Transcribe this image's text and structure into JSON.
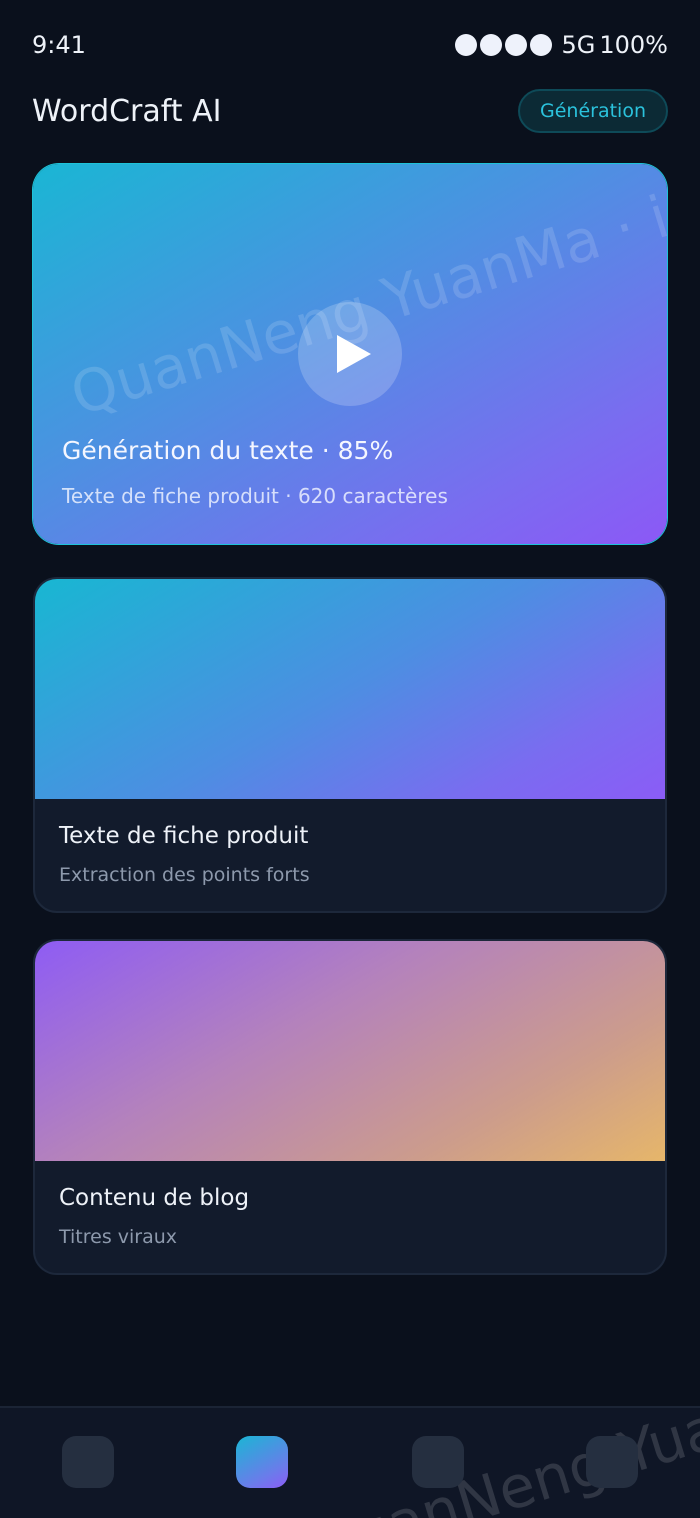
{
  "status_bar": {
    "time": "9:41",
    "network": "5G",
    "battery": "100%",
    "signal_bars": 4
  },
  "header": {
    "title": "WordCraft AI",
    "mode_pill": "Génération"
  },
  "hero": {
    "title": "Génération du texte · 85%",
    "subtitle": "Texte de fiche produit · 620 caractères",
    "progress_percent": 85
  },
  "cards": [
    {
      "title": "Texte de fiche produit",
      "subtitle": "Extraction des points forts"
    },
    {
      "title": "Contenu de blog",
      "subtitle": "Titres viraux"
    }
  ],
  "watermark": "QuanNeng YuanMa · in",
  "watermark_bottom": "QuanNeng YuanMa",
  "bottom_nav": {
    "tabs": [
      "tab-1",
      "tab-2",
      "tab-3",
      "tab-4"
    ],
    "active_index": 1
  },
  "colors": {
    "background": "#0a101c",
    "accent_cyan": "#2bc2dc",
    "accent_purple": "#8c58f6",
    "accent_amber": "#e6b66a"
  }
}
